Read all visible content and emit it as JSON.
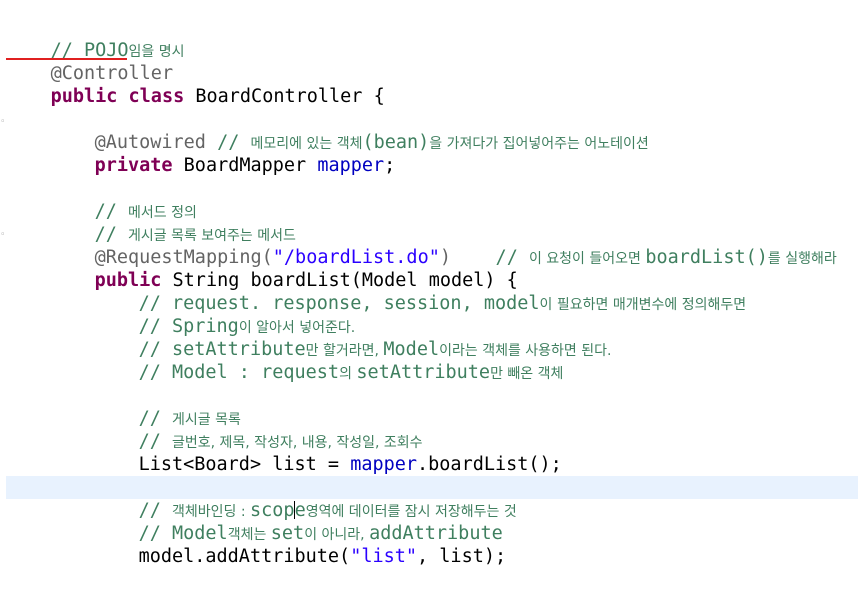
{
  "code": {
    "l1": {
      "slashes": "// ",
      "pojo": "POJO",
      "rest": "임을 명시"
    },
    "l2": {
      "annotation": "@Controller"
    },
    "l3": {
      "kw1": "public",
      "kw2": "class",
      "rest": " BoardController {"
    },
    "l5": {
      "annotation": "@Autowired",
      "slashes": " // ",
      "k1": "메모리에 있는 객체",
      "bean": "(bean)",
      "k2": "을 가져다가 집어넣어주는 어노테이션"
    },
    "l6": {
      "kw": "private",
      "type": " BoardMapper ",
      "field": "mapper",
      "end": ";"
    },
    "l8": {
      "slashes": "// ",
      "k1": "메서드 정의"
    },
    "l9": {
      "slashes": "// ",
      "k1": "게시글 목록 보여주는 메서드"
    },
    "l10": {
      "annotation": "@RequestMapping(",
      "str": "\"/boardList.do\"",
      "close": ")",
      "slashes": "    // ",
      "k1": "이 요청이 들어오면 ",
      "method": "boardList()",
      "k2": "를 실행해라"
    },
    "l11": {
      "kw": "public",
      "rest": " String boardList(Model model) {"
    },
    "l12": {
      "slashes": "// ",
      "t1": "request. response, session, model",
      "k1": "이 필요하면 매개변수에 정의해두면"
    },
    "l13": {
      "slashes": "// ",
      "t1": "Spring",
      "k1": "이 알아서 넣어준다."
    },
    "l14": {
      "slashes": "// ",
      "t1": "setAttribute",
      "k1": "만 할거라면, ",
      "t2": "Model",
      "k2": "이라는 객체를 사용하면 된다."
    },
    "l15": {
      "slashes": "// ",
      "t1": "Model : request",
      "k1": "의 ",
      "t2": "setAttribute",
      "k2": "만 빼온 객체"
    },
    "l17": {
      "slashes": "// ",
      "k1": "게시글 목록"
    },
    "l18": {
      "slashes": "// ",
      "k1": "글번호, 제목, 작성자, 내용, 작성일, 조회수"
    },
    "l19": {
      "t1": "List<Board> list = ",
      "field": "mapper",
      "t2": ".boardList();"
    },
    "l21": {
      "slashes": "// ",
      "k1": "객체바인딩 : ",
      "t1a": "scop",
      "t1b": "e",
      "k2": "영역에 데이터를 잠시 저장해두는 것"
    },
    "l22": {
      "slashes": "// ",
      "t1": "Model",
      "k1": "객체는 ",
      "t2": "set",
      "k2": "이 아니라, ",
      "t3": "addAttribute"
    },
    "l23": {
      "t1": "model.addAttribute(",
      "str": "\"list\"",
      "t2": ", list);"
    }
  },
  "colors": {
    "comment": "#3f7f5f",
    "keyword": "#7f0055",
    "annotation": "#646464",
    "string": "#2a00ff",
    "field": "#0000c0",
    "current_line": "#e8f2fe",
    "error_underline": "#e02020"
  }
}
